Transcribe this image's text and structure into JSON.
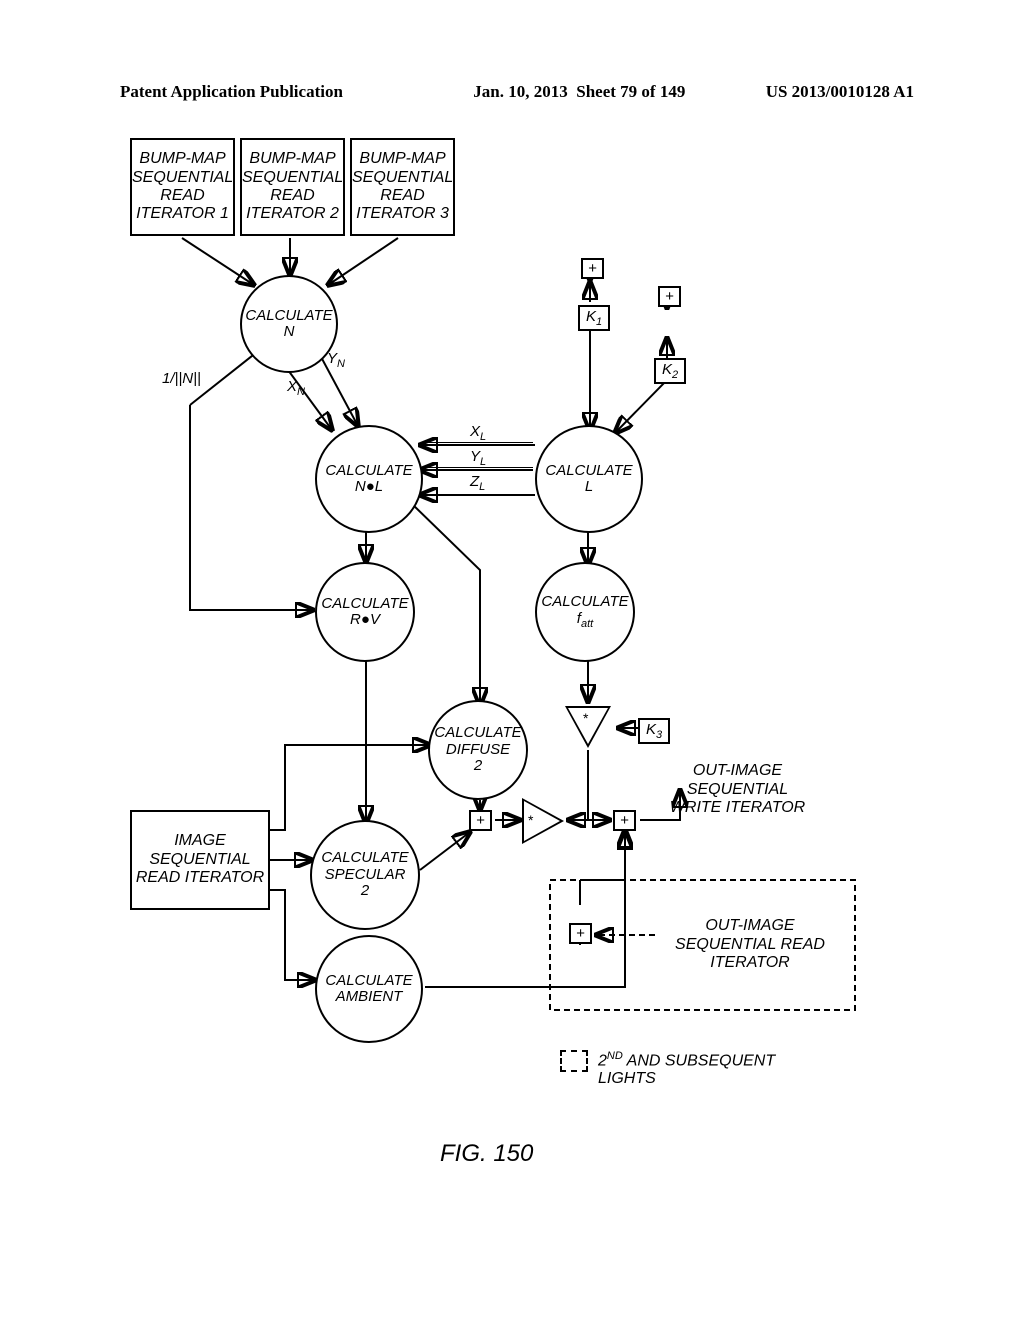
{
  "header": {
    "publication": "Patent Application Publication",
    "date": "Jan. 10, 2013",
    "sheet": "Sheet 79 of 149",
    "pub_number": "US 2013/0010128 A1"
  },
  "boxes": {
    "bump1": "BUMP-MAP SEQUENTIAL READ ITERATOR 1",
    "bump2": "BUMP-MAP SEQUENTIAL READ ITERATOR 2",
    "bump3": "BUMP-MAP SEQUENTIAL READ ITERATOR 3",
    "image_read": "IMAGE SEQUENTIAL READ ITERATOR",
    "out_write": "OUT-IMAGE SEQUENTIAL WRITE ITERATOR",
    "out_read": "OUT-IMAGE SEQUENTIAL READ ITERATOR"
  },
  "constants": {
    "k1": "K",
    "k1_sub": "1",
    "k2": "K",
    "k2_sub": "2",
    "k3": "K",
    "k3_sub": "3",
    "plus": "+",
    "mul": "*"
  },
  "circles": {
    "calc_n": "CALCULATE N",
    "calc_nl": "CALCULATE N●L",
    "calc_l": "CALCULATE L",
    "calc_rv": "CALCULATE R●V",
    "calc_fatt": "CALCULATE",
    "fatt_sym": "f",
    "fatt_sub": "att",
    "calc_diffuse": "CALCULATE DIFFUSE 2",
    "calc_specular": "CALCULATE SPECULAR 2",
    "calc_ambient": "CALCULATE AMBIENT"
  },
  "labels": {
    "inv_norm": "1/||N||",
    "xn": "X",
    "xn_sub": "N",
    "yn": "Y",
    "yn_sub": "N",
    "xl": "X",
    "xl_sub": "L",
    "yl": "Y",
    "yl_sub": "L",
    "zl": "Z",
    "zl_sub": "L"
  },
  "legend": "2ᴺᴰ AND SUBSEQUENT LIGHTS",
  "figure_caption": "FIG. 150"
}
